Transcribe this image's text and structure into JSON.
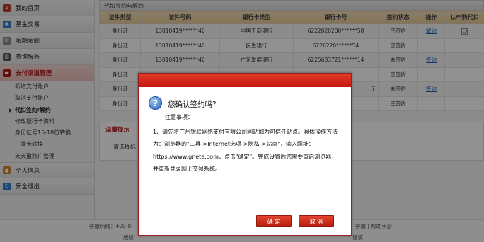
{
  "sidebar": {
    "main_items": [
      {
        "label": "我的首页",
        "icon": "home-icon"
      },
      {
        "label": "基金交易",
        "icon": "fund-icon"
      },
      {
        "label": "定期定额",
        "icon": "calendar-icon"
      },
      {
        "label": "查询服务",
        "icon": "book-icon"
      },
      {
        "label": "支付渠道管理",
        "icon": "card-icon"
      }
    ],
    "sub_items": [
      "新增支付账户",
      "取消支付账户",
      "代扣签约/解约",
      "修改银行卡资料",
      "身份证号15-18位转换",
      "广发卡转换",
      "天天盈账户管理"
    ],
    "bottom_items": [
      {
        "label": "个人信息",
        "icon": "person-icon"
      },
      {
        "label": "安全退出",
        "icon": "power-icon"
      }
    ]
  },
  "panel": {
    "title": "代扣签约与解约"
  },
  "table": {
    "headers": [
      "证件类型",
      "证件号码",
      "银行卡类型",
      "银行卡号",
      "签约状态",
      "操作",
      "认申购代扣"
    ],
    "rows": [
      {
        "type": "身份证",
        "id": "13010419******46",
        "bank": "中国工商银行",
        "card": "6222020200******58",
        "status": "已签约",
        "op": "解约",
        "checked": true
      },
      {
        "type": "身份证",
        "id": "13010419******46",
        "bank": "民生银行",
        "card": "6226220******54",
        "status": "已签约",
        "op": "",
        "checked": false
      },
      {
        "type": "身份证",
        "id": "13010419******46",
        "bank": "广东发展银行",
        "card": "6225683721******14",
        "status": "未签约",
        "op": "签约",
        "checked": false
      },
      {
        "type": "身份证",
        "id": "",
        "bank": "",
        "card": "",
        "status": "已签约",
        "op": "",
        "checked": false
      },
      {
        "type": "身份证",
        "id": "",
        "bank": "",
        "card": "7",
        "status": "未签约",
        "op": "签约",
        "checked": false
      },
      {
        "type": "身份证",
        "id": "",
        "bank": "",
        "card": "",
        "status": "已签约",
        "op": "",
        "checked": false
      }
    ]
  },
  "tips": {
    "title": "温馨提示",
    "text": "请选择标"
  },
  "footer": {
    "hotline": "客服热线：400-8",
    "links": "客服 | 帮助手册",
    "copyright": "版权",
    "trust": "谨慎"
  },
  "dialog": {
    "title": "您确认签约吗?",
    "note": "注意事项：",
    "body": "1、请先将广州银联网络支付有限公司网站加为可信任站点。具体操作方法为：浏览器的\"工具->Internet选项->隐私->站点\"，输入网址：https://www.gnete.com，点击\"确定\"。完成设置后您需要重启浏览器，并重新登录网上交易系统。",
    "confirm_label": "确 定",
    "cancel_label": "取 消"
  },
  "colors": {
    "accent": "#c41810",
    "link": "#1a5fb4",
    "header_row": "#e8c992"
  }
}
